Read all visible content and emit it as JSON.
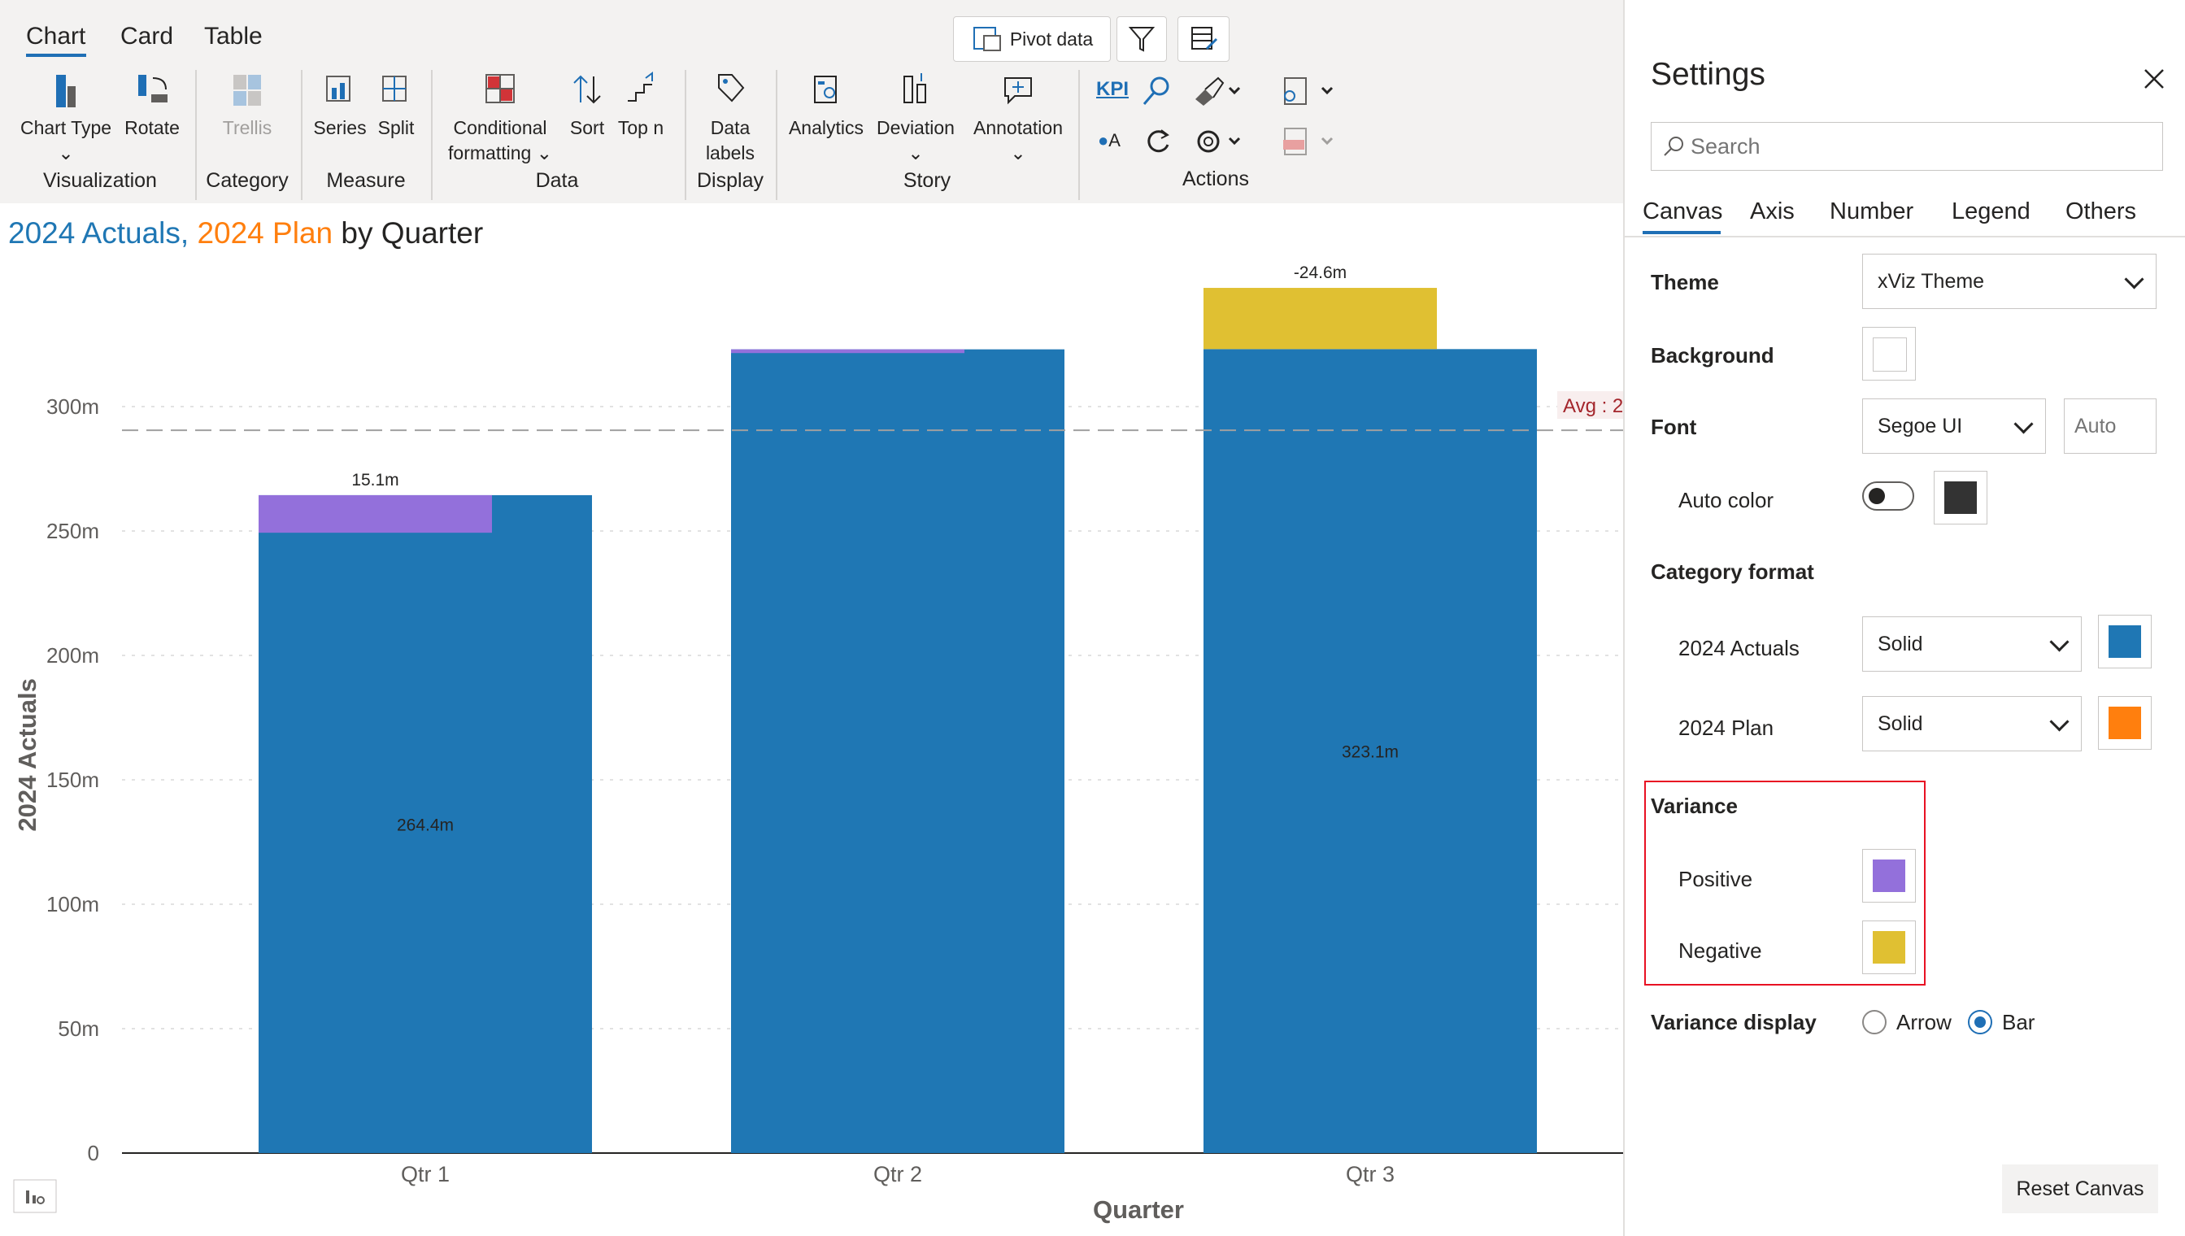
{
  "tabs": [
    {
      "label": "Chart",
      "active": true
    },
    {
      "label": "Card",
      "active": false
    },
    {
      "label": "Table",
      "active": false
    }
  ],
  "top_buttons": {
    "pivot_label": "Pivot data",
    "filter_icon": "filter-settings-icon",
    "table_icon": "table-edit-icon"
  },
  "ribbon": {
    "buttons": [
      {
        "id": "chart-type",
        "label": "Chart Type",
        "icon": "bar-chart-icon"
      },
      {
        "id": "rotate",
        "label": "Rotate",
        "icon": "rotate-icon"
      },
      {
        "id": "trellis",
        "label": "Trellis",
        "icon": "trellis-icon"
      },
      {
        "id": "series",
        "label": "Series",
        "icon": "series-icon"
      },
      {
        "id": "split",
        "label": "Split",
        "icon": "split-icon"
      },
      {
        "id": "conditional-formatting",
        "label1": "Conditional",
        "label2": "formatting",
        "icon": "conditional-formatting-icon"
      },
      {
        "id": "sort",
        "label": "Sort",
        "icon": "sort-icon"
      },
      {
        "id": "top-n",
        "label": "Top n",
        "icon": "top-n-icon"
      },
      {
        "id": "data-labels",
        "label1": "Data",
        "label2": "labels",
        "icon": "tag-icon"
      },
      {
        "id": "analytics",
        "label": "Analytics",
        "icon": "analytics-icon"
      },
      {
        "id": "deviation",
        "label": "Deviation",
        "icon": "deviation-icon"
      },
      {
        "id": "annotation",
        "label": "Annotation",
        "icon": "annotation-icon"
      }
    ],
    "groups": [
      "Visualization",
      "Category",
      "Measure",
      "Data",
      "Display",
      "Story",
      "Actions"
    ],
    "kpi_label": "KPI",
    "a_label": "A"
  },
  "chart_title": {
    "part1": "2024 Actuals,",
    "part2": "2024 Plan",
    "part3": "by Quarter"
  },
  "colors": {
    "actuals": "#1f77b4",
    "plan": "#ff7f0e",
    "positive": "#9370db",
    "negative": "#e0c032",
    "accent": "#1f6fb5",
    "avg_line": "#a0a0a0"
  },
  "chart_data": {
    "type": "bar",
    "categories": [
      "Qtr 1",
      "Qtr 2",
      "Qtr 3"
    ],
    "series": [
      {
        "name": "2024 Actuals",
        "values": [
          264.4,
          323.0,
          323.1
        ]
      },
      {
        "name": "2024 Plan",
        "values": [
          249.3,
          321.5,
          347.7
        ]
      }
    ],
    "variance": [
      15.1,
      1.5,
      -24.6
    ],
    "data_labels": [
      "264.4m",
      "",
      "323.1m"
    ],
    "variance_labels": [
      "15.1m",
      "",
      "-24.6m"
    ],
    "xlabel": "Quarter",
    "ylabel": "2024 Actuals",
    "ylim": [
      0,
      330
    ],
    "yticks": [
      0,
      50,
      100,
      150,
      200,
      250,
      300
    ],
    "ytick_labels": [
      "0",
      "50m",
      "100m",
      "150m",
      "200m",
      "250m",
      "300m"
    ],
    "avg_value": 290.5,
    "avg_label": "Avg : 2",
    "grid": true
  },
  "settings": {
    "title": "Settings",
    "search_placeholder": "Search",
    "tabs": [
      "Canvas",
      "Axis",
      "Number",
      "Legend",
      "Others"
    ],
    "active_tab": "Canvas",
    "theme_label": "Theme",
    "theme_value": "xViz Theme",
    "background_label": "Background",
    "font_label": "Font",
    "font_value": "Segoe UI",
    "font_size_placeholder": "Auto",
    "auto_color_label": "Auto color",
    "category_format_label": "Category format",
    "actuals_label": "2024 Actuals",
    "actuals_style": "Solid",
    "plan_label": "2024 Plan",
    "plan_style": "Solid",
    "variance_label": "Variance",
    "positive_label": "Positive",
    "negative_label": "Negative",
    "variance_display_label": "Variance display",
    "arrow_label": "Arrow",
    "bar_label": "Bar",
    "variance_display_value": "Bar",
    "reset_label": "Reset Canvas"
  }
}
